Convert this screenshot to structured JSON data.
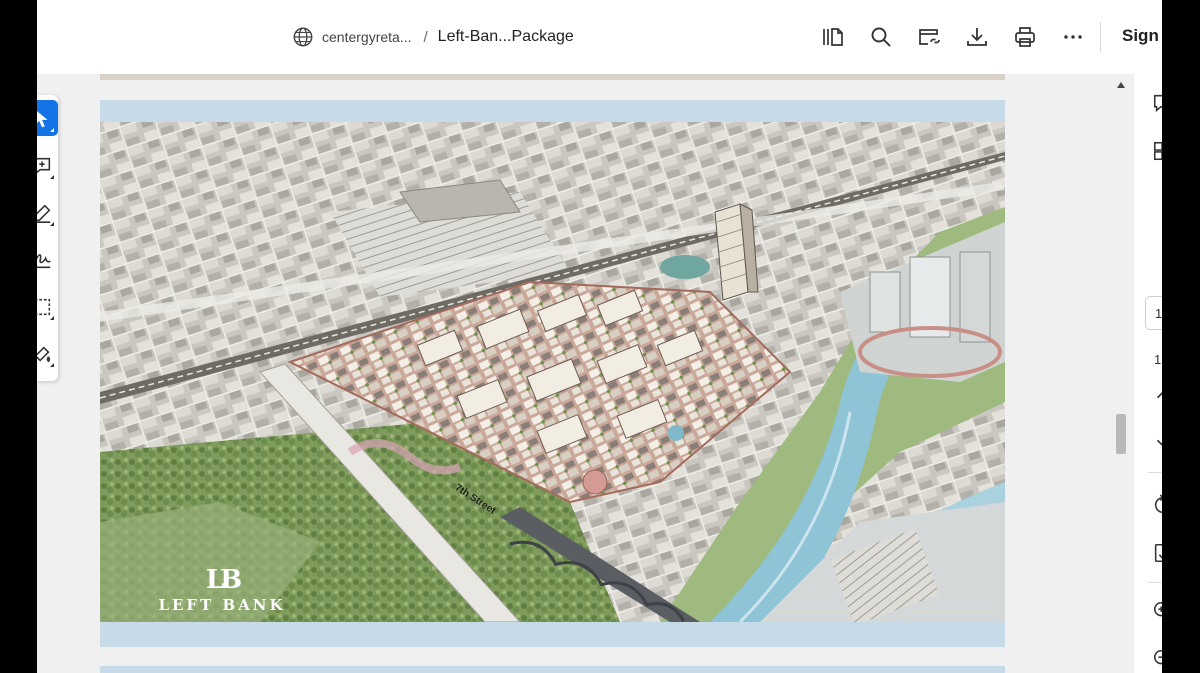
{
  "breadcrumb": {
    "domain": "centergyreta...",
    "separator": "/",
    "filename": "Left-Ban...Package"
  },
  "toolbar": {
    "icons": [
      "page-thumbnails-icon",
      "search-icon",
      "share-link-icon",
      "download-icon",
      "print-icon",
      "more-options-icon"
    ],
    "sign_in_label": "Sign in"
  },
  "left_tools": [
    "select-tool-icon",
    "add-comment-icon",
    "draw-pen-icon",
    "signature-icon",
    "crop-select-icon",
    "fill-sign-icon"
  ],
  "document": {
    "street_label": "7th Street",
    "logo_mark": "LB",
    "logo_text": "LEFT BANK"
  },
  "right_rail": {
    "page_current": "1",
    "page_total": "1",
    "icons": [
      "comment-icon",
      "organize-pages-icon",
      "previous-page-icon",
      "next-page-icon",
      "rotate-icon",
      "save-page-icon",
      "zoom-in-icon",
      "zoom-out-icon"
    ]
  },
  "colors": {
    "accent": "#1473e6",
    "page_frame": "#c6dbe7",
    "river": "#8fc3d6",
    "park_green": "#8aa86a"
  }
}
